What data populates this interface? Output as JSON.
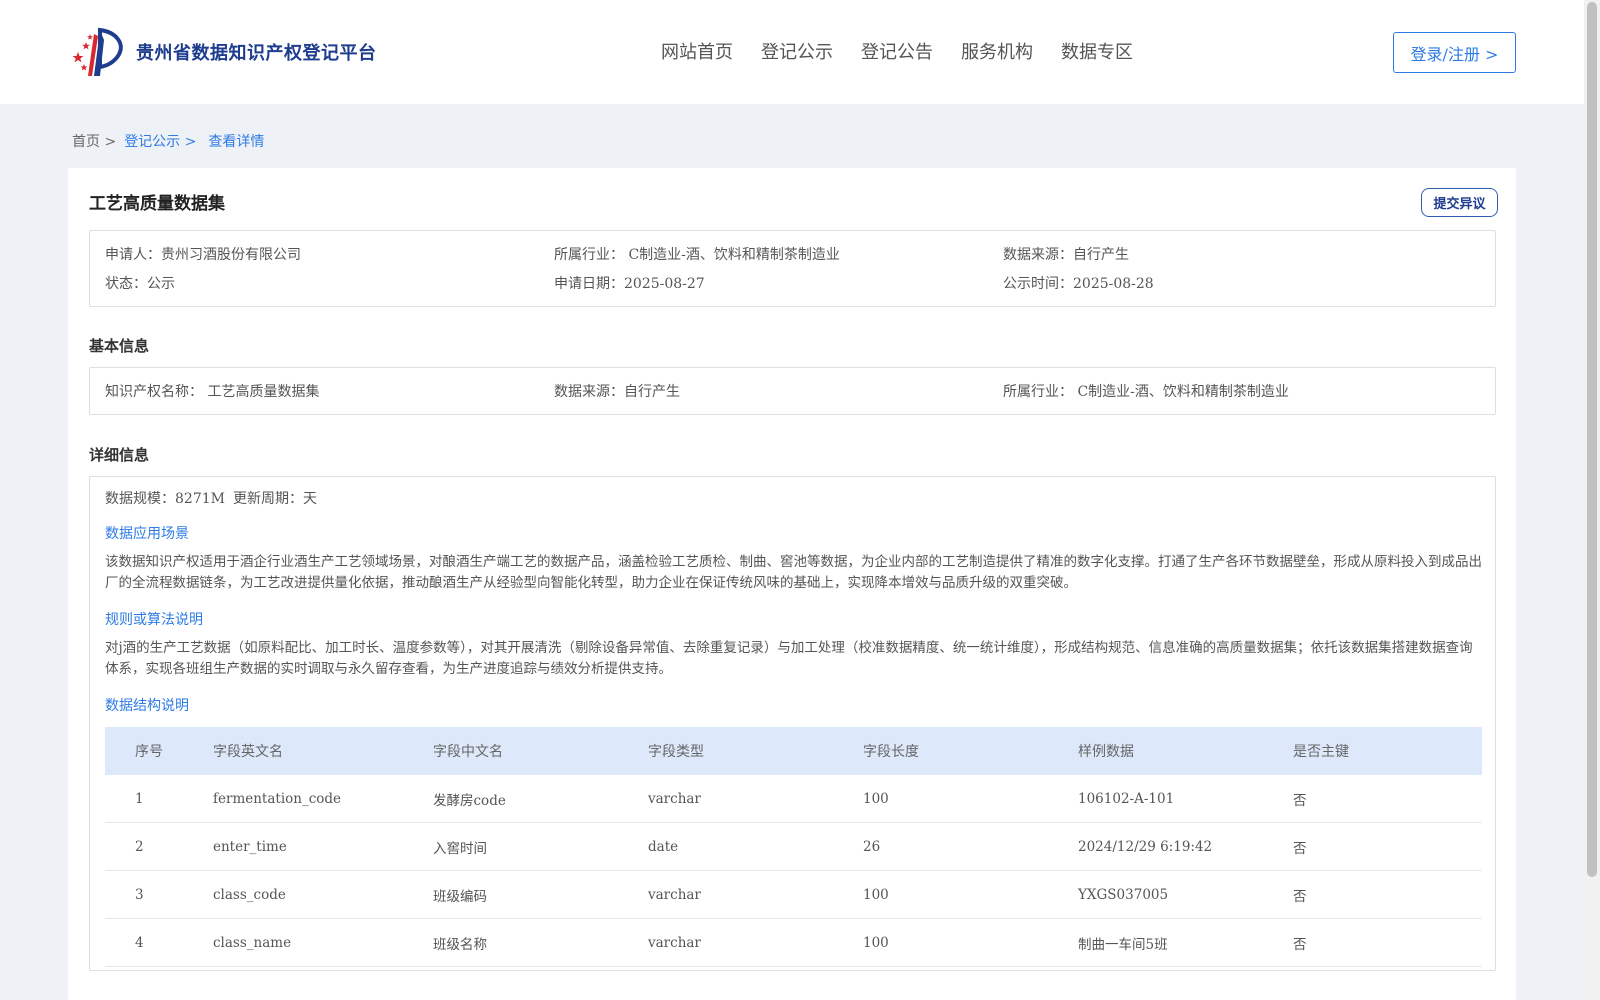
{
  "header": {
    "site_title": "贵州省数据知识产权登记平台",
    "nav": [
      "网站首页",
      "登记公示",
      "登记公告",
      "服务机构",
      "数据专区"
    ],
    "login_label": "登录/注册 >"
  },
  "breadcrumb": {
    "home": "首页 >",
    "registry": "登记公示 >",
    "current": "查看详情"
  },
  "detail": {
    "title": "工艺高质量数据集",
    "objection_label": "提交异议",
    "summary": {
      "applicant": "申请人：贵州习酒股份有限公司",
      "industry": "所属行业： C制造业-酒、饮料和精制茶制造业",
      "source": "数据来源：自行产生",
      "status": "状态：公示",
      "apply_date": "申请日期：2025-08-27",
      "publish_time": "公示时间：2025-08-28"
    },
    "basic_title": "基本信息",
    "basic": {
      "ip_name": "知识产权名称： 工艺高质量数据集",
      "source": "数据来源：自行产生",
      "industry": "所属行业： C制造业-酒、饮料和精制茶制造业"
    },
    "detail_title": "详细信息",
    "scale": "数据规模：8271M",
    "cycle": "更新周期：天",
    "scene_title": "数据应用场景",
    "scene_text": "该数据知识产权适用于酒企行业酒生产工艺领域场景，对酿酒生产端工艺的数据产品，涵盖检验工艺质检、制曲、窖池等数据，为企业内部的工艺制造提供了精准的数字化支撑。打通了生产各环节数据壁垒，形成从原料投入到成品出厂的全流程数据链条，为工艺改进提供量化依据，推动酿酒生产从经验型向智能化转型，助力企业在保证传统风味的基础上，实现降本增效与品质升级的双重突破。",
    "rule_title": "规则或算法说明",
    "rule_text": "对j酒的生产工艺数据（如原料配比、加工时长、温度参数等），对其开展清洗（剔除设备异常值、去除重复记录）与加工处理（校准数据精度、统一统计维度），形成结构规范、信息准确的高质量数据集；依托该数据集搭建数据查询体系，实现各班组生产数据的实时调取与永久留存查看，为生产进度追踪与绩效分析提供支持。",
    "struct_title": "数据结构说明"
  },
  "table": {
    "headers": [
      "序号",
      "字段英文名",
      "字段中文名",
      "字段类型",
      "字段长度",
      "样例数据",
      "是否主键"
    ],
    "rows": [
      [
        "1",
        "fermentation_code",
        "发酵房code",
        "varchar",
        "100",
        "106102-A-101",
        "否"
      ],
      [
        "2",
        "enter_time",
        "入窖时间",
        "date",
        "26",
        "2024/12/29 6:19:42",
        "否"
      ],
      [
        "3",
        "class_code",
        "班级编码",
        "varchar",
        "100",
        "YXGS037005",
        "否"
      ],
      [
        "4",
        "class_name",
        "班级名称",
        "varchar",
        "100",
        "制曲一车间5班",
        "否"
      ]
    ]
  },
  "colors": {
    "accent": "#2d7be5",
    "brand_dark": "#1f3d8f",
    "table_header_bg": "#dde9fb",
    "page_bg": "#eef1f5"
  }
}
